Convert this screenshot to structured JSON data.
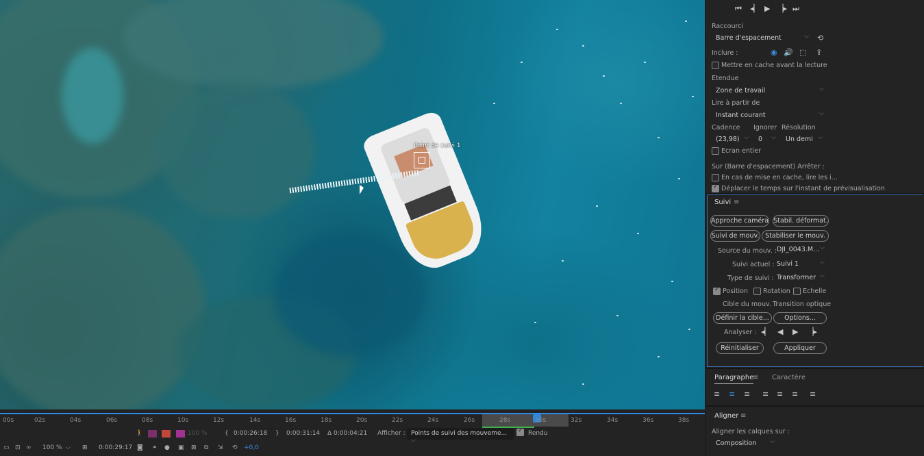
{
  "viewer": {
    "track_point_label": "Point de suivi 1"
  },
  "timeline": {
    "ruler_ticks": [
      "00s",
      "02s",
      "04s",
      "06s",
      "08s",
      "10s",
      "12s",
      "14s",
      "16s",
      "18s",
      "20s",
      "22s",
      "24s",
      "26s",
      "28s",
      "30s",
      "32s",
      "34s",
      "36s",
      "38s"
    ],
    "zoom": "100 %",
    "time_current": "0:00:29:17",
    "in_time": "0:00:26:18",
    "out_time": "0:00:31:14",
    "duration": "Δ 0:00:04:21",
    "resolution_pct": "100 %",
    "afficher_label": "Afficher :",
    "afficher_value": "Points de suivi des mouveme...",
    "rendu_label": "Rendu",
    "rendu_checked": true,
    "exposure": "+0,0"
  },
  "preview": {
    "raccourci_label": "Raccourci",
    "raccourci_value": "Barre d'espacement",
    "inclure_label": "Inclure :",
    "cache_label": "Mettre en cache avant la lecture",
    "etendue_label": "Etendue",
    "etendue_value": "Zone de travail",
    "lire_label": "Lire à partir de",
    "lire_value": "Instant courant",
    "cadence_label": "Cadence",
    "ignorer_label": "Ignorer",
    "resolution_label": "Résolution",
    "cadence_value": "(23,98)",
    "ignorer_value": "0",
    "resolution_value": "Un demi",
    "ecran_label": "Ecran entier",
    "sur_label": "Sur (Barre d'espacement) Arrêter :",
    "cache_opt_label": "En cas de mise en cache, lire les i...",
    "deplacer_label": "Déplacer le temps sur l'instant de prévisualisation"
  },
  "suivi": {
    "title": "Suivi",
    "btn_approche": "Approche caméra",
    "btn_stabil": "Stabil. déformat.",
    "btn_suivi_mouv": "Suivi de mouv.",
    "btn_stabiliser": "Stabiliser le mouv.",
    "source_label": "Source du mouv. :",
    "source_value": "DJI_0043.M...",
    "suivi_actuel_label": "Suivi actuel :",
    "suivi_actuel_value": "Suivi 1",
    "type_label": "Type de suivi :",
    "type_value": "Transformer",
    "position_label": "Position",
    "rotation_label": "Rotation",
    "echelle_label": "Echelle",
    "position_checked": true,
    "rotation_checked": false,
    "echelle_checked": false,
    "cible_label": "Cible du mouv. :",
    "cible_value": "Transition optique",
    "btn_definir": "Définir la cible...",
    "btn_options": "Options...",
    "analyser_label": "Analyser :",
    "btn_reinit": "Réinitialiser",
    "btn_appliquer": "Appliquer"
  },
  "paragraphe": {
    "tab_paragraphe": "Paragraphe",
    "tab_caractere": "Caractère"
  },
  "aligner": {
    "title": "Aligner",
    "aligner_sur_label": "Aligner les calques sur :",
    "aligner_sur_value": "Composition"
  },
  "colors": {
    "accent": "#2e86de",
    "panel_bg": "#232323",
    "focus_border": "#3d6fb5"
  }
}
